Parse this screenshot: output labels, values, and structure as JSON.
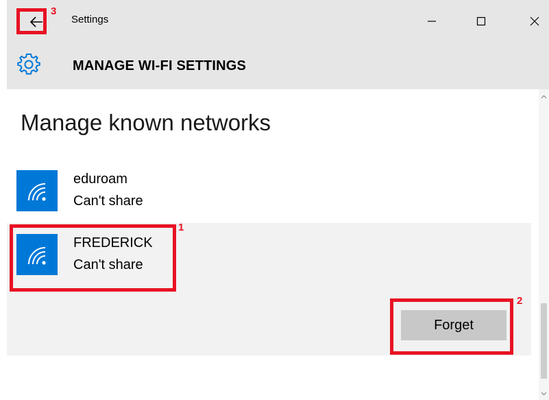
{
  "window": {
    "title": "Settings",
    "minimize_icon": "minimize-icon",
    "maximize_icon": "maximize-icon",
    "close_icon": "close-icon"
  },
  "header": {
    "icon": "gear-icon",
    "title": "MANAGE WI-FI SETTINGS"
  },
  "content": {
    "section_title": "Manage known networks",
    "networks": [
      {
        "name": "eduroam",
        "status": "Can't share",
        "icon": "wifi-icon",
        "selected": false
      },
      {
        "name": "FREDERICK",
        "status": "Can't share",
        "icon": "wifi-icon",
        "selected": true
      }
    ],
    "forget_label": "Forget"
  },
  "annotations": [
    "1",
    "2",
    "3"
  ],
  "colors": {
    "accent": "#0078d7",
    "annotation": "#e81123",
    "titlebar": "#e6e6e6",
    "selected_row": "#f2f2f2",
    "button": "#c8c8c8"
  }
}
